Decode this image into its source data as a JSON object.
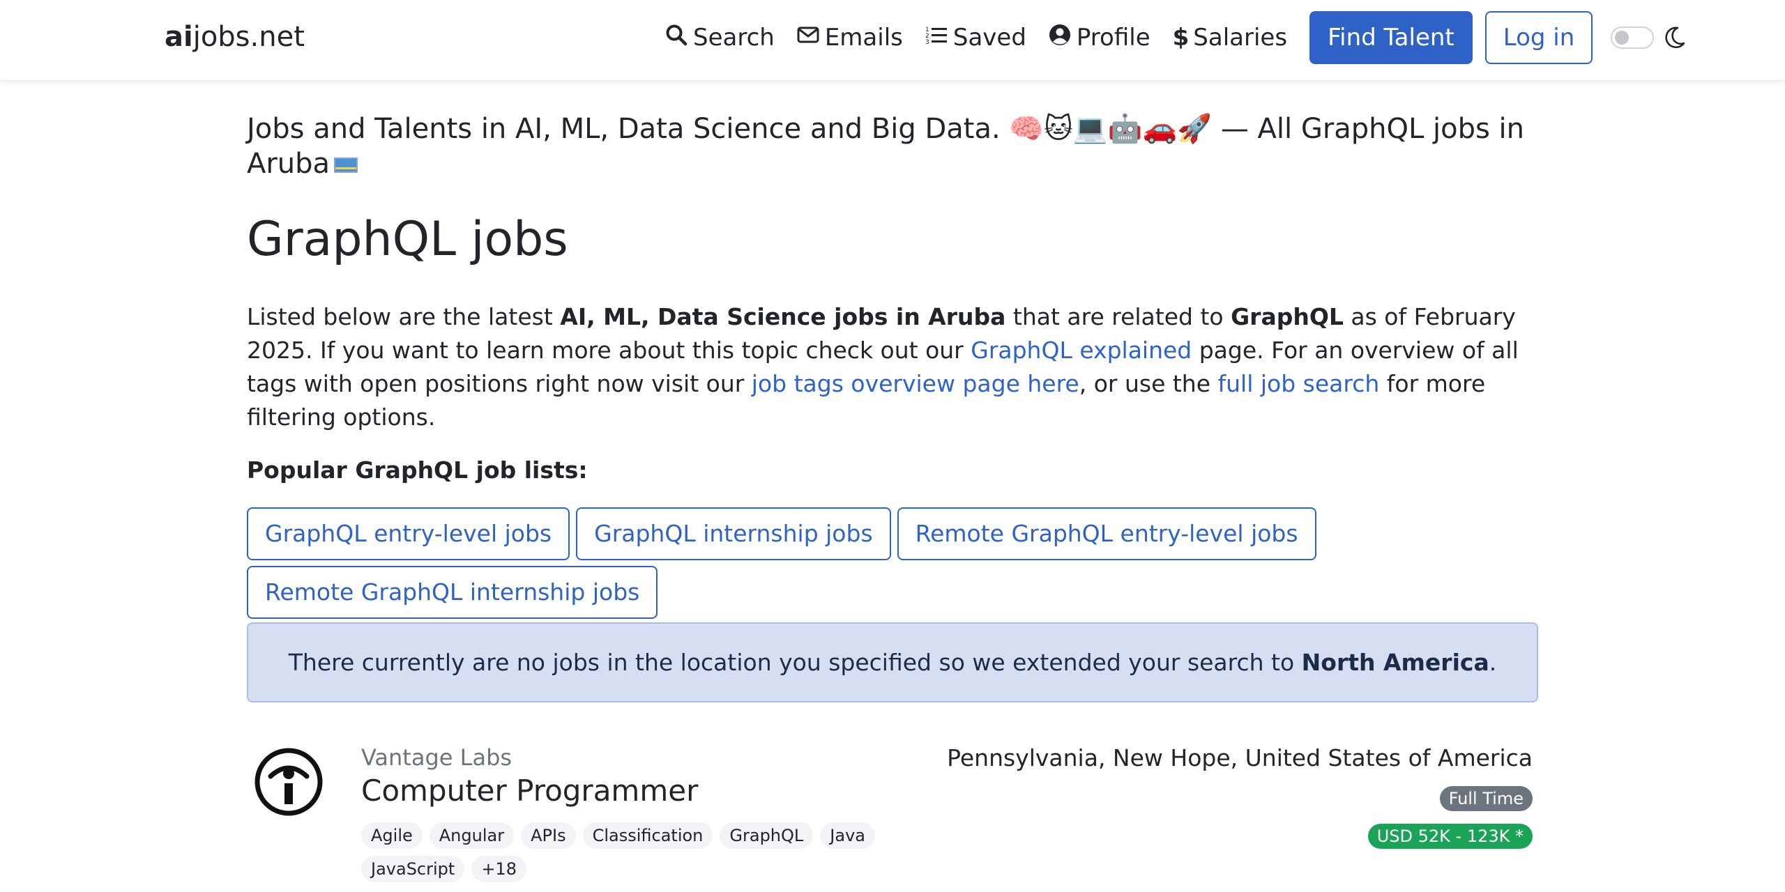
{
  "navbar": {
    "brand_bold": "ai",
    "brand_rest": "jobs.net",
    "links": [
      {
        "label": "Search",
        "icon": "search-icon"
      },
      {
        "label": "Emails",
        "icon": "envelope-icon"
      },
      {
        "label": "Saved",
        "icon": "list-icon"
      },
      {
        "label": "Profile",
        "icon": "user-circle-icon"
      },
      {
        "label": "Salaries",
        "icon": "dollar-icon"
      }
    ],
    "find_talent": "Find Talent",
    "login": "Log in"
  },
  "tagline": {
    "text": "Jobs and Talents in AI, ML, Data Science and Big Data. 🧠🐱💻🤖🚗🚀 — All GraphQL jobs in Aruba"
  },
  "page_title": "GraphQL jobs",
  "intro": {
    "p1": "Listed below are the latest ",
    "b1": "AI, ML, Data Science jobs in Aruba",
    "p2": " that are related to ",
    "b2": "GraphQL",
    "p3": " as of February 2025. If you want to learn more about this topic check out our ",
    "link1": "GraphQL explained",
    "p4": " page. For an overview of all tags with open positions right now visit our ",
    "link2": "job tags overview page here",
    "p5": ", or use the ",
    "link3": "full job search",
    "p6": " for more filtering options."
  },
  "popular_heading": "Popular GraphQL job lists:",
  "popular_lists": [
    "GraphQL entry-level jobs",
    "GraphQL internship jobs",
    "Remote GraphQL entry-level jobs",
    "Remote GraphQL internship jobs"
  ],
  "alert": {
    "text": "There currently are no jobs in the location you specified so we extended your search to ",
    "region": "North America",
    "end": "."
  },
  "job": {
    "company": "Vantage Labs",
    "title": "Computer Programmer",
    "location": "Pennsylvania, New Hope, United States of America",
    "type": "Full Time",
    "salary": "USD 52K - 123K *",
    "tags": [
      "Agile",
      "Angular",
      "APIs",
      "Classification",
      "GraphQL",
      "Java",
      "JavaScript",
      "+18"
    ]
  },
  "colors": {
    "primary": "#2f62c6",
    "salary_badge": "#1ba357",
    "type_badge": "#6c757d",
    "alert_bg": "#d6dff2"
  }
}
